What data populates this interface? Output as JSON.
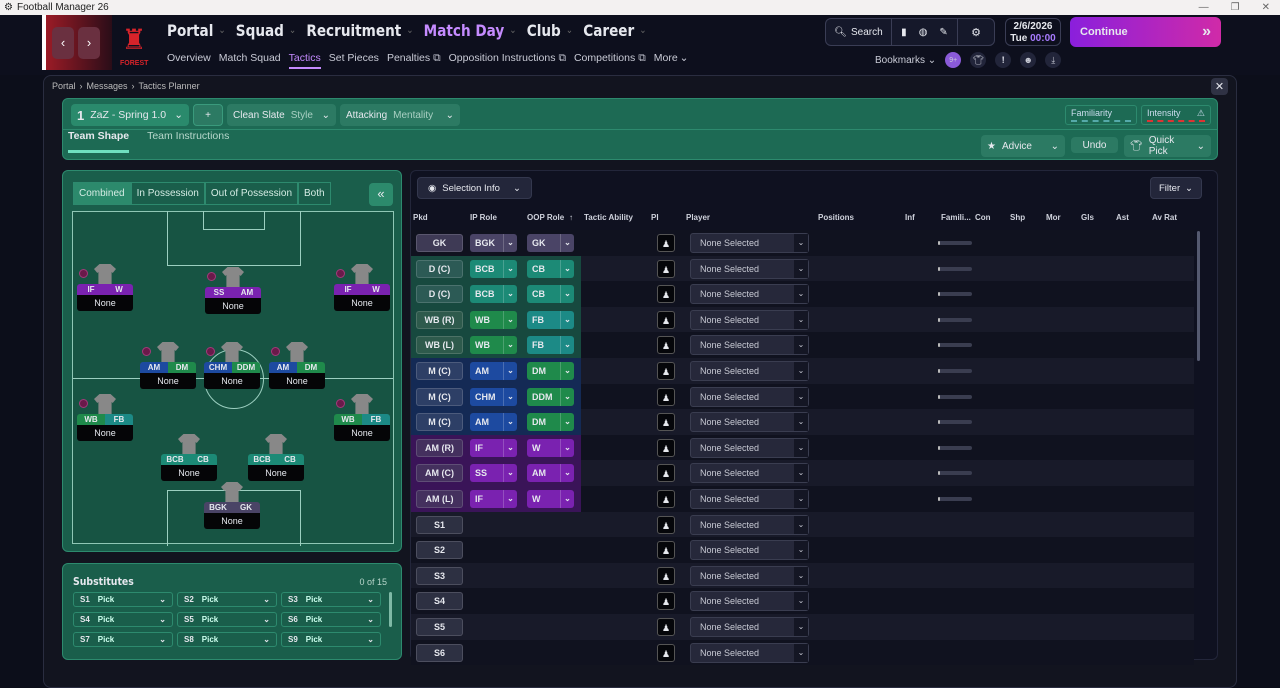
{
  "window": {
    "title": "Football Manager 26"
  },
  "nav": {
    "main": [
      "Portal",
      "Squad",
      "Recruitment",
      "Match Day",
      "Club",
      "Career"
    ],
    "active_main": "Match Day",
    "sub": [
      "Overview",
      "Match Squad",
      "Tactics",
      "Set Pieces",
      "Penalties",
      "Opposition Instructions",
      "Competitions",
      "More"
    ],
    "active_sub": "Tactics",
    "crest_text": "FOREST",
    "search": "Search",
    "date": "2/6/2026",
    "day": "Tue",
    "time": "00:00",
    "continue": "Continue",
    "bookmarks": "Bookmarks",
    "notif_badge": "9+"
  },
  "breadcrumb": [
    "Portal",
    "Messages",
    "Tactics Planner"
  ],
  "toolbar": {
    "tactic_num": "1",
    "tactic_name": "ZaZ - Spring 1.0",
    "add": "+",
    "style_value": "Clean Slate",
    "style_label": "Style",
    "mentality_value": "Attacking",
    "mentality_label": "Mentality",
    "familiarity": "Familiarity",
    "intensity": "Intensity",
    "tabs": [
      "Team Shape",
      "Team Instructions"
    ],
    "advice": "Advice",
    "undo": "Undo",
    "quick_pick": "Quick Pick"
  },
  "pitch": {
    "view_tabs": [
      "Combined",
      "In Possession",
      "Out of Possession",
      "Both"
    ],
    "active_view": "Combined",
    "collapse": "«",
    "players": [
      {
        "ip": "IF",
        "oop": "W",
        "name": "None",
        "color": "#7a22b0"
      },
      {
        "ip": "SS",
        "oop": "AM",
        "name": "None",
        "color": "#7a22b0"
      },
      {
        "ip": "IF",
        "oop": "W",
        "name": "None",
        "color": "#7a22b0"
      },
      {
        "ip": "AM",
        "oop": "DM",
        "name": "None",
        "color": "#1d4aa0",
        "color2": "#1f8a4b"
      },
      {
        "ip": "CHM",
        "oop": "DDM",
        "name": "None",
        "color": "#1d4aa0",
        "color2": "#1f8a4b"
      },
      {
        "ip": "AM",
        "oop": "DM",
        "name": "None",
        "color": "#1d4aa0",
        "color2": "#1f8a4b"
      },
      {
        "ip": "WB",
        "oop": "FB",
        "name": "None",
        "color": "#1f8a4b",
        "color2": "#1c8a86"
      },
      {
        "ip": "WB",
        "oop": "FB",
        "name": "None",
        "color": "#1f8a4b",
        "color2": "#1c8a86"
      },
      {
        "ip": "BCB",
        "oop": "CB",
        "name": "None",
        "color": "#1c8a76"
      },
      {
        "ip": "BCB",
        "oop": "CB",
        "name": "None",
        "color": "#1c8a76"
      },
      {
        "ip": "BGK",
        "oop": "GK",
        "name": "None",
        "color": "#4a4466"
      }
    ]
  },
  "substitutes": {
    "title": "Substitutes",
    "count": "0 of 15",
    "slots": [
      {
        "id": "S1",
        "value": "Pick"
      },
      {
        "id": "S2",
        "value": "Pick"
      },
      {
        "id": "S3",
        "value": "Pick"
      },
      {
        "id": "S4",
        "value": "Pick"
      },
      {
        "id": "S5",
        "value": "Pick"
      },
      {
        "id": "S6",
        "value": "Pick"
      },
      {
        "id": "S7",
        "value": "Pick"
      },
      {
        "id": "S8",
        "value": "Pick"
      },
      {
        "id": "S9",
        "value": "Pick"
      }
    ]
  },
  "table": {
    "selection_info": "Selection Info",
    "filter": "Filter",
    "columns": [
      "Pkd",
      "IP Role",
      "OOP Role",
      "Tactic Ability",
      "PI",
      "Player",
      "Positions",
      "Inf",
      "Famili...",
      "Con",
      "Shp",
      "Mor",
      "Gls",
      "Ast",
      "Av Rat"
    ],
    "sort_column": "OOP Role",
    "rows": [
      {
        "pkd": "GK",
        "ip": "BGK",
        "oop": "GK",
        "player": "None Selected",
        "group": "gk"
      },
      {
        "pkd": "D (C)",
        "ip": "BCB",
        "oop": "CB",
        "player": "None Selected",
        "group": "d"
      },
      {
        "pkd": "D (C)",
        "ip": "BCB",
        "oop": "CB",
        "player": "None Selected",
        "group": "d"
      },
      {
        "pkd": "WB (R)",
        "ip": "WB",
        "oop": "FB",
        "player": "None Selected",
        "group": "wb"
      },
      {
        "pkd": "WB (L)",
        "ip": "WB",
        "oop": "FB",
        "player": "None Selected",
        "group": "wb"
      },
      {
        "pkd": "M (C)",
        "ip": "AM",
        "oop": "DM",
        "player": "None Selected",
        "group": "m"
      },
      {
        "pkd": "M (C)",
        "ip": "CHM",
        "oop": "DDM",
        "player": "None Selected",
        "group": "m"
      },
      {
        "pkd": "M (C)",
        "ip": "AM",
        "oop": "DM",
        "player": "None Selected",
        "group": "m"
      },
      {
        "pkd": "AM (R)",
        "ip": "IF",
        "oop": "W",
        "player": "None Selected",
        "group": "am"
      },
      {
        "pkd": "AM (C)",
        "ip": "SS",
        "oop": "AM",
        "player": "None Selected",
        "group": "am"
      },
      {
        "pkd": "AM (L)",
        "ip": "IF",
        "oop": "W",
        "player": "None Selected",
        "group": "am"
      },
      {
        "pkd": "S1",
        "player": "None Selected",
        "group": "s"
      },
      {
        "pkd": "S2",
        "player": "None Selected",
        "group": "s"
      },
      {
        "pkd": "S3",
        "player": "None Selected",
        "group": "s"
      },
      {
        "pkd": "S4",
        "player": "None Selected",
        "group": "s"
      },
      {
        "pkd": "S5",
        "player": "None Selected",
        "group": "s"
      },
      {
        "pkd": "S6",
        "player": "None Selected",
        "group": "s"
      }
    ]
  },
  "colors": {
    "accent": "#c58bff",
    "continue_start": "#8a1fdc",
    "continue_end": "#d02aa8",
    "panel_green": "#1d6a54"
  }
}
